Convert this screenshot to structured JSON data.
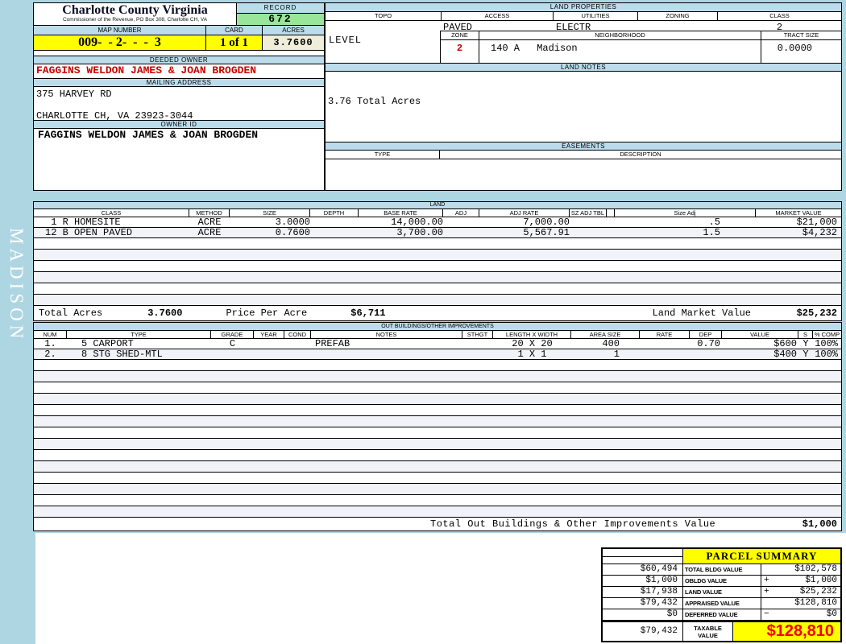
{
  "sidebar": {
    "district": "MADISON"
  },
  "header": {
    "county": "Charlotte County Virginia",
    "commissioner": "Commissioner of the Revenue, PO Box 308, Charlotte CH, VA",
    "record_label": "RECORD",
    "record_value": "672",
    "map_number_label": "MAP NUMBER",
    "map_number": "009-  - 2-  -  -  3",
    "card_label": "CARD",
    "card_value": "1 of 1",
    "acres_label": "ACRES",
    "acres_value": "3.7600"
  },
  "owner": {
    "deeded_owner_label": "DEEDED OWNER",
    "deeded_owner": "FAGGINS WELDON JAMES & JOAN BROGDEN",
    "mailing_address_label": "MAILING ADDRESS",
    "address_line1": "375 HARVEY RD",
    "address_line2": "CHARLOTTE CH, VA 23923-3044",
    "owner_id_label": "OWNER ID",
    "owner_id": "FAGGINS WELDON JAMES & JOAN BROGDEN"
  },
  "land_properties": {
    "title": "LAND PROPERTIES",
    "topo_label": "TOPO",
    "access_label": "ACCESS",
    "utilities_label": "UTILITIES",
    "zoning_label": "ZONING",
    "class_label": "CLASS",
    "topo": "LEVEL",
    "access": "PAVED",
    "utilities": "ELECTR",
    "class": "2",
    "zone_label": "ZONE",
    "zone": "2",
    "neighborhood_label": "NEIGHBORHOOD",
    "neighborhood_code": "140 A",
    "neighborhood": "Madison",
    "tract_size_label": "TRACT SIZE",
    "tract_size": "0.0000"
  },
  "land_notes": {
    "title": "LAND NOTES",
    "note": "3.76 Total Acres"
  },
  "easements": {
    "title": "EASEMENTS",
    "type_label": "TYPE",
    "description_label": "DESCRIPTION"
  },
  "land": {
    "title": "LAND",
    "columns": [
      "CLASS",
      "METHOD",
      "SIZE",
      "DEPTH",
      "BASE RATE",
      "ADJ",
      "ADJ RATE",
      "SZ ADJ TBL",
      "",
      "Size Adj",
      "MARKET VALUE"
    ],
    "rows": [
      {
        "class": " 1 R HOMESITE",
        "method": "ACRE",
        "size": "3.0000",
        "base_rate": "14,000.00",
        "adj_rate": "7,000.00",
        "size_adj": ".5",
        "market_value": "$21,000"
      },
      {
        "class": "12 B OPEN PAVED",
        "method": "ACRE",
        "size": "0.7600",
        "base_rate": "3,700.00",
        "adj_rate": "5,567.91",
        "size_adj": "1.5",
        "market_value": "$4,232"
      }
    ],
    "total_acres_label": "Total Acres",
    "total_acres": "3.7600",
    "price_per_acre_label": "Price Per Acre",
    "price_per_acre": "$6,711",
    "market_value_label": "Land Market Value",
    "market_value": "$25,232"
  },
  "out_buildings": {
    "title": "OUT BUILDINGS/OTHER IMPROVEMENTS",
    "columns": [
      "NUM",
      "TYPE",
      "GRADE",
      "YEAR",
      "COND",
      "NOTES",
      "STHGT",
      "LENGTH X WIDTH",
      "AREA SIZE",
      "RATE",
      "DEP",
      "VALUE",
      "S",
      "% COMP"
    ],
    "rows": [
      {
        "num": "1.",
        "type": "5 CARPORT",
        "grade": "C",
        "notes": "PREFAB",
        "lw": "20 X 20",
        "area": "400",
        "dep": "0.70",
        "value": "$600",
        "s": "Y",
        "comp": "100%"
      },
      {
        "num": "2.",
        "type": "8 STG SHED-MTL",
        "lw": "1 X 1",
        "area": "1",
        "value": "$400",
        "s": "Y",
        "comp": "100%"
      }
    ],
    "total_label": "Total Out Buildings & Other Improvements Value",
    "total_value": "$1,000"
  },
  "parcel_summary": {
    "title": "PARCEL SUMMARY",
    "rows": [
      {
        "prior": "$60,494",
        "label": "TOTAL BLDG VALUE",
        "op": "",
        "value": "$102,578"
      },
      {
        "prior": "$1,000",
        "label": "OBLDG VALUE",
        "op": "+",
        "value": "$1,000"
      },
      {
        "prior": "$17,938",
        "label": "LAND VALUE",
        "op": "+",
        "value": "$25,232"
      },
      {
        "prior": "$79,432",
        "label": "APPRAISED VALUE",
        "op": "",
        "value": "$128,810"
      },
      {
        "prior": "$0",
        "label": "DEFERRED VALUE",
        "op": "−",
        "value": "$0"
      }
    ],
    "taxable": {
      "prior": "$79,432",
      "label": "TAXABLE VALUE",
      "value": "$128,810"
    }
  },
  "colors": {
    "page_background": "#aed6e2",
    "section_bar": "#bcdcec",
    "record_green": "#99e599",
    "highlight_yellow": "#ffff00",
    "acres_beige": "#efeeda",
    "alt_row": "#f1f3f9",
    "owner_red": "#cc0000",
    "taxable_red": "#f00000"
  }
}
